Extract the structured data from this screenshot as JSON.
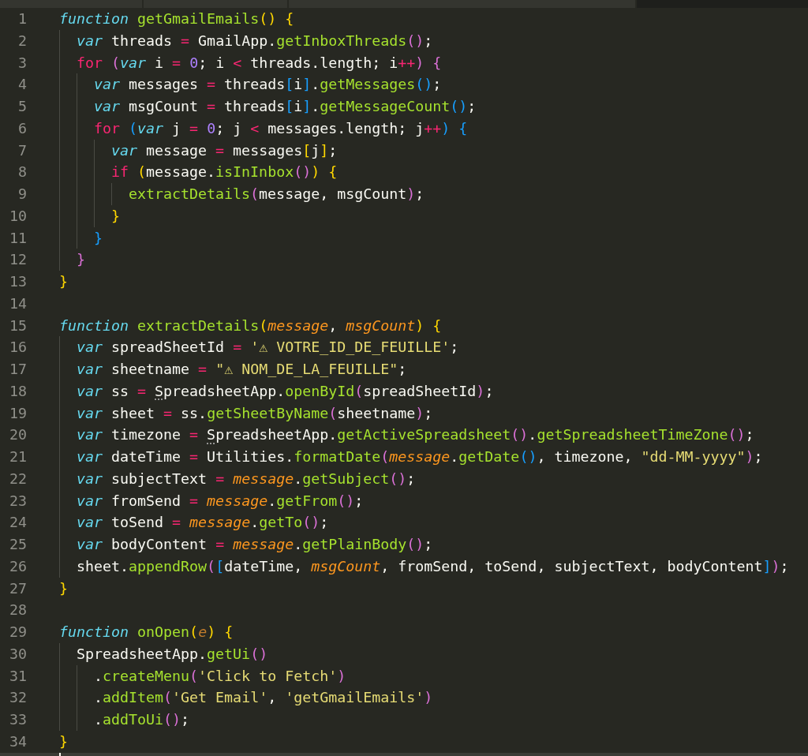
{
  "editor": {
    "lines": [
      {
        "number": "1",
        "tokens": [
          {
            "kind": "kw",
            "text": "function"
          },
          {
            "kind": "fn",
            "text": " getGmailEmails"
          },
          {
            "kind": "b1",
            "text": "()"
          },
          {
            "kind": "b1",
            "text": " {"
          }
        ]
      },
      {
        "number": "2",
        "tokens": [
          {
            "kind": "kw",
            "text": "  var"
          },
          {
            "kind": "plain",
            "text": " threads "
          },
          {
            "kind": "op",
            "text": "="
          },
          {
            "kind": "plain",
            "text": " GmailApp."
          },
          {
            "kind": "fn",
            "text": "getInboxThreads"
          },
          {
            "kind": "b2",
            "text": "()"
          },
          {
            "kind": "plain",
            "text": ";"
          }
        ]
      },
      {
        "number": "3",
        "tokens": [
          {
            "kind": "ctl",
            "text": "  for"
          },
          {
            "kind": "b2",
            "text": " ("
          },
          {
            "kind": "kw",
            "text": "var"
          },
          {
            "kind": "plain",
            "text": " i "
          },
          {
            "kind": "op",
            "text": "="
          },
          {
            "kind": "num",
            "text": " 0"
          },
          {
            "kind": "plain",
            "text": "; i "
          },
          {
            "kind": "op",
            "text": "<"
          },
          {
            "kind": "plain",
            "text": " threads.length; i"
          },
          {
            "kind": "op",
            "text": "++"
          },
          {
            "kind": "b2",
            "text": ")"
          },
          {
            "kind": "b2",
            "text": " {"
          }
        ]
      },
      {
        "number": "4",
        "tokens": [
          {
            "kind": "kw",
            "text": "    var"
          },
          {
            "kind": "plain",
            "text": " messages "
          },
          {
            "kind": "op",
            "text": "="
          },
          {
            "kind": "plain",
            "text": " threads"
          },
          {
            "kind": "b3",
            "text": "["
          },
          {
            "kind": "plain",
            "text": "i"
          },
          {
            "kind": "b3",
            "text": "]"
          },
          {
            "kind": "plain",
            "text": "."
          },
          {
            "kind": "fn",
            "text": "getMessages"
          },
          {
            "kind": "b3",
            "text": "()"
          },
          {
            "kind": "plain",
            "text": ";"
          }
        ]
      },
      {
        "number": "5",
        "tokens": [
          {
            "kind": "kw",
            "text": "    var"
          },
          {
            "kind": "plain",
            "text": " msgCount "
          },
          {
            "kind": "op",
            "text": "="
          },
          {
            "kind": "plain",
            "text": " threads"
          },
          {
            "kind": "b3",
            "text": "["
          },
          {
            "kind": "plain",
            "text": "i"
          },
          {
            "kind": "b3",
            "text": "]"
          },
          {
            "kind": "plain",
            "text": "."
          },
          {
            "kind": "fn",
            "text": "getMessageCount"
          },
          {
            "kind": "b3",
            "text": "()"
          },
          {
            "kind": "plain",
            "text": ";"
          }
        ]
      },
      {
        "number": "6",
        "tokens": [
          {
            "kind": "ctl",
            "text": "    for"
          },
          {
            "kind": "b3",
            "text": " ("
          },
          {
            "kind": "kw",
            "text": "var"
          },
          {
            "kind": "plain",
            "text": " j "
          },
          {
            "kind": "op",
            "text": "="
          },
          {
            "kind": "num",
            "text": " 0"
          },
          {
            "kind": "plain",
            "text": "; j "
          },
          {
            "kind": "op",
            "text": "<"
          },
          {
            "kind": "plain",
            "text": " messages.length; j"
          },
          {
            "kind": "op",
            "text": "++"
          },
          {
            "kind": "b3",
            "text": ")"
          },
          {
            "kind": "b3",
            "text": " {"
          }
        ]
      },
      {
        "number": "7",
        "tokens": [
          {
            "kind": "kw",
            "text": "      var"
          },
          {
            "kind": "plain",
            "text": " message "
          },
          {
            "kind": "op",
            "text": "="
          },
          {
            "kind": "plain",
            "text": " messages"
          },
          {
            "kind": "b1",
            "text": "["
          },
          {
            "kind": "plain",
            "text": "j"
          },
          {
            "kind": "b1",
            "text": "]"
          },
          {
            "kind": "plain",
            "text": ";"
          }
        ]
      },
      {
        "number": "8",
        "tokens": [
          {
            "kind": "ctl",
            "text": "      if"
          },
          {
            "kind": "b1",
            "text": " ("
          },
          {
            "kind": "plain",
            "text": "message."
          },
          {
            "kind": "fn",
            "text": "isInInbox"
          },
          {
            "kind": "b2",
            "text": "()"
          },
          {
            "kind": "b1",
            "text": ")"
          },
          {
            "kind": "b1",
            "text": " {"
          }
        ]
      },
      {
        "number": "9",
        "tokens": [
          {
            "kind": "fn",
            "text": "        extractDetails"
          },
          {
            "kind": "b2",
            "text": "("
          },
          {
            "kind": "plain",
            "text": "message, msgCount"
          },
          {
            "kind": "b2",
            "text": ")"
          },
          {
            "kind": "plain",
            "text": ";"
          }
        ]
      },
      {
        "number": "10",
        "tokens": [
          {
            "kind": "b1",
            "text": "      }"
          }
        ]
      },
      {
        "number": "11",
        "tokens": [
          {
            "kind": "b3",
            "text": "    }"
          }
        ]
      },
      {
        "number": "12",
        "tokens": [
          {
            "kind": "b2",
            "text": "  }"
          }
        ]
      },
      {
        "number": "13",
        "tokens": [
          {
            "kind": "b1",
            "text": "}"
          }
        ]
      },
      {
        "number": "14"
      },
      {
        "number": "15",
        "tokens": [
          {
            "kind": "kw",
            "text": "function"
          },
          {
            "kind": "fn",
            "text": " extractDetails"
          },
          {
            "kind": "b1",
            "text": "("
          },
          {
            "kind": "param",
            "text": "message"
          },
          {
            "kind": "plain",
            "text": ", "
          },
          {
            "kind": "param",
            "text": "msgCount"
          },
          {
            "kind": "b1",
            "text": ")"
          },
          {
            "kind": "b1",
            "text": " {"
          }
        ]
      },
      {
        "number": "16",
        "tokens": [
          {
            "kind": "kw",
            "text": "  var"
          },
          {
            "kind": "plain",
            "text": " spreadSheetId "
          },
          {
            "kind": "op",
            "text": "="
          },
          {
            "kind": "str",
            "text": " '⚠ VOTRE_ID_DE_FEUILLE'"
          },
          {
            "kind": "plain",
            "text": ";"
          }
        ]
      },
      {
        "number": "17",
        "tokens": [
          {
            "kind": "kw",
            "text": "  var"
          },
          {
            "kind": "plain",
            "text": " sheetname "
          },
          {
            "kind": "op",
            "text": "="
          },
          {
            "kind": "str",
            "text": " \"⚠ NOM_DE_LA_FEUILLE\""
          },
          {
            "kind": "plain",
            "text": ";"
          }
        ]
      },
      {
        "number": "18",
        "tokens": [
          {
            "kind": "kw",
            "text": "  var"
          },
          {
            "kind": "plain",
            "text": " ss "
          },
          {
            "kind": "op",
            "text": "= "
          },
          {
            "kind": "hint",
            "text": "S"
          },
          {
            "kind": "plain",
            "text": "preadsheetApp."
          },
          {
            "kind": "fn",
            "text": "openById"
          },
          {
            "kind": "b2",
            "text": "("
          },
          {
            "kind": "plain",
            "text": "spreadSheetId"
          },
          {
            "kind": "b2",
            "text": ")"
          },
          {
            "kind": "plain",
            "text": ";"
          }
        ]
      },
      {
        "number": "19",
        "tokens": [
          {
            "kind": "kw",
            "text": "  var"
          },
          {
            "kind": "plain",
            "text": " sheet "
          },
          {
            "kind": "op",
            "text": "="
          },
          {
            "kind": "plain",
            "text": " ss."
          },
          {
            "kind": "fn",
            "text": "getSheetByName"
          },
          {
            "kind": "b2",
            "text": "("
          },
          {
            "kind": "plain",
            "text": "sheetname"
          },
          {
            "kind": "b2",
            "text": ")"
          },
          {
            "kind": "plain",
            "text": ";"
          }
        ]
      },
      {
        "number": "20",
        "tokens": [
          {
            "kind": "kw",
            "text": "  var"
          },
          {
            "kind": "plain",
            "text": " timezone "
          },
          {
            "kind": "op",
            "text": "= "
          },
          {
            "kind": "hint",
            "text": "S"
          },
          {
            "kind": "plain",
            "text": "preadsheetApp."
          },
          {
            "kind": "fn",
            "text": "getActiveSpreadsheet"
          },
          {
            "kind": "b2",
            "text": "()"
          },
          {
            "kind": "plain",
            "text": "."
          },
          {
            "kind": "fn",
            "text": "getSpreadsheetTimeZone"
          },
          {
            "kind": "b2",
            "text": "()"
          },
          {
            "kind": "plain",
            "text": ";"
          }
        ]
      },
      {
        "number": "21",
        "tokens": [
          {
            "kind": "kw",
            "text": "  var"
          },
          {
            "kind": "plain",
            "text": " dateTime "
          },
          {
            "kind": "op",
            "text": "="
          },
          {
            "kind": "plain",
            "text": " Utilities."
          },
          {
            "kind": "fn",
            "text": "formatDate"
          },
          {
            "kind": "b2",
            "text": "("
          },
          {
            "kind": "param",
            "text": "message"
          },
          {
            "kind": "plain",
            "text": "."
          },
          {
            "kind": "fn",
            "text": "getDate"
          },
          {
            "kind": "b3",
            "text": "()"
          },
          {
            "kind": "plain",
            "text": ", timezone, "
          },
          {
            "kind": "str",
            "text": "\"dd-MM-yyyy\""
          },
          {
            "kind": "b2",
            "text": ")"
          },
          {
            "kind": "plain",
            "text": ";"
          }
        ]
      },
      {
        "number": "22",
        "tokens": [
          {
            "kind": "kw",
            "text": "  var"
          },
          {
            "kind": "plain",
            "text": " subjectText "
          },
          {
            "kind": "op",
            "text": "="
          },
          {
            "kind": "param",
            "text": " message"
          },
          {
            "kind": "plain",
            "text": "."
          },
          {
            "kind": "fn",
            "text": "getSubject"
          },
          {
            "kind": "b2",
            "text": "()"
          },
          {
            "kind": "plain",
            "text": ";"
          }
        ]
      },
      {
        "number": "23",
        "tokens": [
          {
            "kind": "kw",
            "text": "  var"
          },
          {
            "kind": "plain",
            "text": " fromSend "
          },
          {
            "kind": "op",
            "text": "="
          },
          {
            "kind": "param",
            "text": " message"
          },
          {
            "kind": "plain",
            "text": "."
          },
          {
            "kind": "fn",
            "text": "getFrom"
          },
          {
            "kind": "b2",
            "text": "()"
          },
          {
            "kind": "plain",
            "text": ";"
          }
        ]
      },
      {
        "number": "24",
        "tokens": [
          {
            "kind": "kw",
            "text": "  var"
          },
          {
            "kind": "plain",
            "text": " toSend "
          },
          {
            "kind": "op",
            "text": "="
          },
          {
            "kind": "param",
            "text": " message"
          },
          {
            "kind": "plain",
            "text": "."
          },
          {
            "kind": "fn",
            "text": "getTo"
          },
          {
            "kind": "b2",
            "text": "()"
          },
          {
            "kind": "plain",
            "text": ";"
          }
        ]
      },
      {
        "number": "25",
        "tokens": [
          {
            "kind": "kw",
            "text": "  var"
          },
          {
            "kind": "plain",
            "text": " bodyContent "
          },
          {
            "kind": "op",
            "text": "="
          },
          {
            "kind": "param",
            "text": " message"
          },
          {
            "kind": "plain",
            "text": "."
          },
          {
            "kind": "fn",
            "text": "getPlainBody"
          },
          {
            "kind": "b2",
            "text": "()"
          },
          {
            "kind": "plain",
            "text": ";"
          }
        ]
      },
      {
        "number": "26",
        "tokens": [
          {
            "kind": "plain",
            "text": "  sheet."
          },
          {
            "kind": "fn",
            "text": "appendRow"
          },
          {
            "kind": "b2",
            "text": "("
          },
          {
            "kind": "b3",
            "text": "["
          },
          {
            "kind": "plain",
            "text": "dateTime, "
          },
          {
            "kind": "param",
            "text": "msgCount"
          },
          {
            "kind": "plain",
            "text": ", fromSend, toSend, subjectText, bodyContent"
          },
          {
            "kind": "b3",
            "text": "]"
          },
          {
            "kind": "b2",
            "text": ")"
          },
          {
            "kind": "plain",
            "text": ";"
          }
        ]
      },
      {
        "number": "27",
        "tokens": [
          {
            "kind": "b1",
            "text": "}"
          }
        ]
      },
      {
        "number": "28"
      },
      {
        "number": "29",
        "tokens": [
          {
            "kind": "kw",
            "text": "function"
          },
          {
            "kind": "fn",
            "text": " onOpen"
          },
          {
            "kind": "b1",
            "text": "("
          },
          {
            "kind": "param2",
            "text": "e"
          },
          {
            "kind": "b1",
            "text": ")"
          },
          {
            "kind": "b1",
            "text": " {"
          }
        ]
      },
      {
        "number": "30",
        "tokens": [
          {
            "kind": "plain",
            "text": "  SpreadsheetApp."
          },
          {
            "kind": "fn",
            "text": "getUi"
          },
          {
            "kind": "b2",
            "text": "()"
          }
        ]
      },
      {
        "number": "31",
        "tokens": [
          {
            "kind": "plain",
            "text": "    ."
          },
          {
            "kind": "fn",
            "text": "createMenu"
          },
          {
            "kind": "b2",
            "text": "("
          },
          {
            "kind": "str",
            "text": "'Click to Fetch'"
          },
          {
            "kind": "b2",
            "text": ")"
          }
        ]
      },
      {
        "number": "32",
        "tokens": [
          {
            "kind": "plain",
            "text": "    ."
          },
          {
            "kind": "fn",
            "text": "addItem"
          },
          {
            "kind": "b2",
            "text": "("
          },
          {
            "kind": "str",
            "text": "'Get Email'"
          },
          {
            "kind": "plain",
            "text": ", "
          },
          {
            "kind": "str",
            "text": "'getGmailEmails'"
          },
          {
            "kind": "b2",
            "text": ")"
          }
        ]
      },
      {
        "number": "33",
        "tokens": [
          {
            "kind": "plain",
            "text": "    ."
          },
          {
            "kind": "fn",
            "text": "addToUi"
          },
          {
            "kind": "b2",
            "text": "()"
          },
          {
            "kind": "plain",
            "text": ";"
          }
        ]
      },
      {
        "number": "34",
        "tokens": [
          {
            "kind": "b1",
            "text": "}"
          }
        ]
      }
    ]
  }
}
